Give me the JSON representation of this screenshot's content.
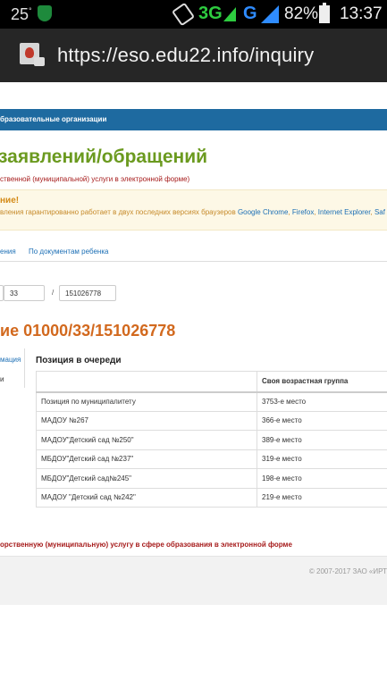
{
  "status_bar": {
    "temperature": "25",
    "network_3g": "3G",
    "network_g": "G",
    "battery_percent": "82%",
    "time": "13:37"
  },
  "browser": {
    "url": "https://eso.edu22.info/inquiry"
  },
  "navbar": {
    "label": "бразовательные организации"
  },
  "header": {
    "title": "заявлений/обращений",
    "subtitle": "ственной (муниципальной) услуги в электронной форме)"
  },
  "alert": {
    "heading": "ние!",
    "text": "вления гарантированно работает в двух последних версиях браузеров ",
    "browsers": [
      "Google Chrome",
      "Firefox",
      "Internet Explorer",
      "Saf"
    ]
  },
  "tabs": [
    {
      "label": "ения"
    },
    {
      "label": "По документам ребенка"
    }
  ],
  "search": {
    "part1": "",
    "part2": "33",
    "separator": "/",
    "part3": "151026778"
  },
  "application": {
    "title": "ие 01000/33/151026778"
  },
  "side_menu": [
    {
      "label": "мация"
    },
    {
      "label": "и"
    }
  ],
  "queue": {
    "heading": "Позиция в очереди",
    "columns": [
      "",
      "Своя возрастная группа"
    ],
    "rows": [
      {
        "name": "Позиция по муниципалитету",
        "value": "3753-е место"
      },
      {
        "name": "МАДОУ №267",
        "value": "366-е место"
      },
      {
        "name": "МАДОУ\"Детский сад №250\"",
        "value": "389-е место"
      },
      {
        "name": "МБДОУ\"Детский сад №237\"",
        "value": "319-е место"
      },
      {
        "name": "МБДОУ\"Детский сад№245\"",
        "value": "198-е место"
      },
      {
        "name": "МАДОУ \"Детский сад №242\"",
        "value": "219-е место"
      }
    ]
  },
  "footer": {
    "link": "орственную (муниципальную) услугу в сфере образования в электронной форме",
    "copyright": "© 2007-2017 ЗАО «ИРТ"
  }
}
